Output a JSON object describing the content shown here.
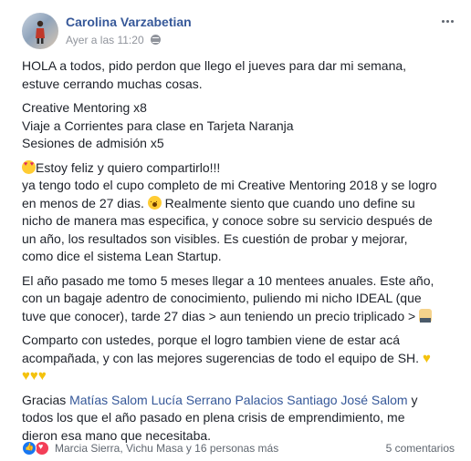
{
  "post": {
    "author": "Carolina Varzabetian",
    "timestamp": "Ayer a las 11:20",
    "paragraphs": [
      [
        "HOLA a todos, pido perdon que llego el jueves para dar mi semana,",
        "estuve cerrando muchas cosas."
      ],
      [
        "Creative Mentoring x8",
        "Viaje a Corrientes para clase en Tarjeta Naranja",
        "Sesiones de admisión x5"
      ]
    ],
    "p3": {
      "l1": "Estoy feliz y quiero compartirlo!!!",
      "l2": "ya tengo todo el cupo completo de mi Creative Mentoring 2018 y se logro",
      "l3a": "en menos de 27 dias.",
      "l3b": " Realmente siento que cuando uno define su",
      "l4": "nicho de manera mas especifica, y conoce sobre su servicio después de",
      "l5": "un año, los resultados son visibles. Es cuestión de probar y mejorar,",
      "l6": "como dice el sistema Lean Startup."
    },
    "p4": {
      "l1": "El año pasado me tomo 5 meses llegar a 10 mentees anuales. Este año,",
      "l2": "con un bagaje adentro de conocimiento, puliendo mi nicho IDEAL (que",
      "l3": "tuve que conocer), tarde 27 dias > aun teniendo un precio triplicado > "
    },
    "p5": {
      "l1": "Comparto con ustedes, porque el logro tambien viene de estar acá",
      "l2": "acompañada, y con las mejores sugerencias de todo el equipo de SH. "
    },
    "p6": {
      "prefix": "Gracias ",
      "mentions": [
        "Matías Salom",
        "Lucía Serrano Palacios",
        "Santiago José Salom"
      ],
      "suffix": " y",
      "l2": "todos los que el año pasado en plena crisis de emprendimiento, me",
      "l3": "dieron esa mano que necesitaba."
    }
  },
  "footer": {
    "reacted_by": "Marcia Sierra, Vichu Masa y 16 personas más",
    "comments": "5 comentarios"
  },
  "icons": {
    "more": "more-options-icon",
    "audience": "globe-icon",
    "reactions": [
      "like-reaction-icon",
      "love-reaction-icon"
    ]
  },
  "colors": {
    "link": "#365899",
    "meta": "#90949c",
    "text": "#1d2129",
    "like": "#1877f2",
    "love": "#f33e58"
  }
}
